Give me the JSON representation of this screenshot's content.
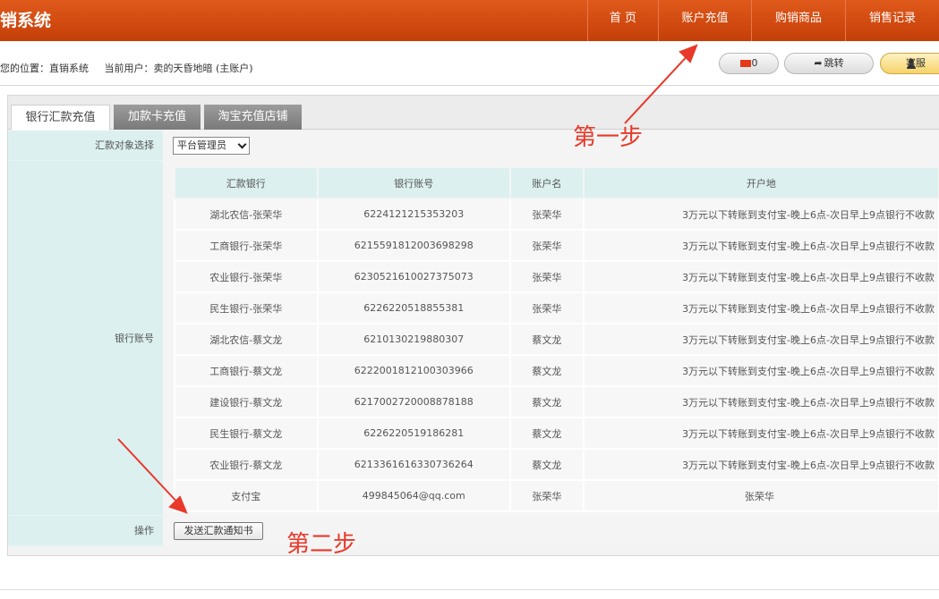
{
  "header": {
    "title": "销系统",
    "nav": [
      "首 页",
      "账户充值",
      "购销商品",
      "销售记录"
    ]
  },
  "infobar": {
    "location": "您的位置：直销系统",
    "current_user": "当前用户：卖的天昏地暗 (主账户)",
    "msg_count": "0",
    "jump_label": "跳转",
    "service_label": "客服"
  },
  "tabs": [
    "银行汇款充值",
    "加款卡充值",
    "淘宝充值店铺"
  ],
  "form": {
    "target_label": "汇款对象选择",
    "target_value": "平台管理员",
    "bank_label": "银行账号",
    "action_label": "操作",
    "send_button": "发送汇款通知书"
  },
  "table": {
    "headers": [
      "汇款银行",
      "银行账号",
      "账户名",
      "开户地"
    ],
    "rows": [
      [
        "湖北农信-张荣华",
        "6224121215353203",
        "张荣华",
        "3万元以下转账到支付宝-晚上6点-次日早上9点银行不收款"
      ],
      [
        "工商银行-张荣华",
        "6215591812003698298",
        "张荣华",
        "3万元以下转账到支付宝-晚上6点-次日早上9点银行不收款"
      ],
      [
        "农业银行-张荣华",
        "6230521610027375073",
        "张荣华",
        "3万元以下转账到支付宝-晚上6点-次日早上9点银行不收款"
      ],
      [
        "民生银行-张荣华",
        "6226220518855381",
        "张荣华",
        "3万元以下转账到支付宝-晚上6点-次日早上9点银行不收款"
      ],
      [
        "湖北农信-蔡文龙",
        "6210130219880307",
        "蔡文龙",
        "3万元以下转账到支付宝-晚上6点-次日早上9点银行不收款"
      ],
      [
        "工商银行-蔡文龙",
        "6222001812100303966",
        "蔡文龙",
        "3万元以下转账到支付宝-晚上6点-次日早上9点银行不收款"
      ],
      [
        "建设银行-蔡文龙",
        "6217002720008878188",
        "蔡文龙",
        "3万元以下转账到支付宝-晚上6点-次日早上9点银行不收款"
      ],
      [
        "民生银行-蔡文龙",
        "6226220519186281",
        "蔡文龙",
        "3万元以下转账到支付宝-晚上6点-次日早上9点银行不收款"
      ],
      [
        "农业银行-蔡文龙",
        "6213361616330736264",
        "蔡文龙",
        "3万元以下转账到支付宝-晚上6点-次日早上9点银行不收款"
      ],
      [
        "支付宝",
        "499845064@qq.com",
        "张荣华",
        "张荣华"
      ]
    ]
  },
  "annotations": {
    "step1": "第一步",
    "step2": "第二步"
  },
  "colors": {
    "header_orange": "#d54a12",
    "annotation_red": "#e8392a",
    "label_cyan": "#dcf0f0"
  }
}
